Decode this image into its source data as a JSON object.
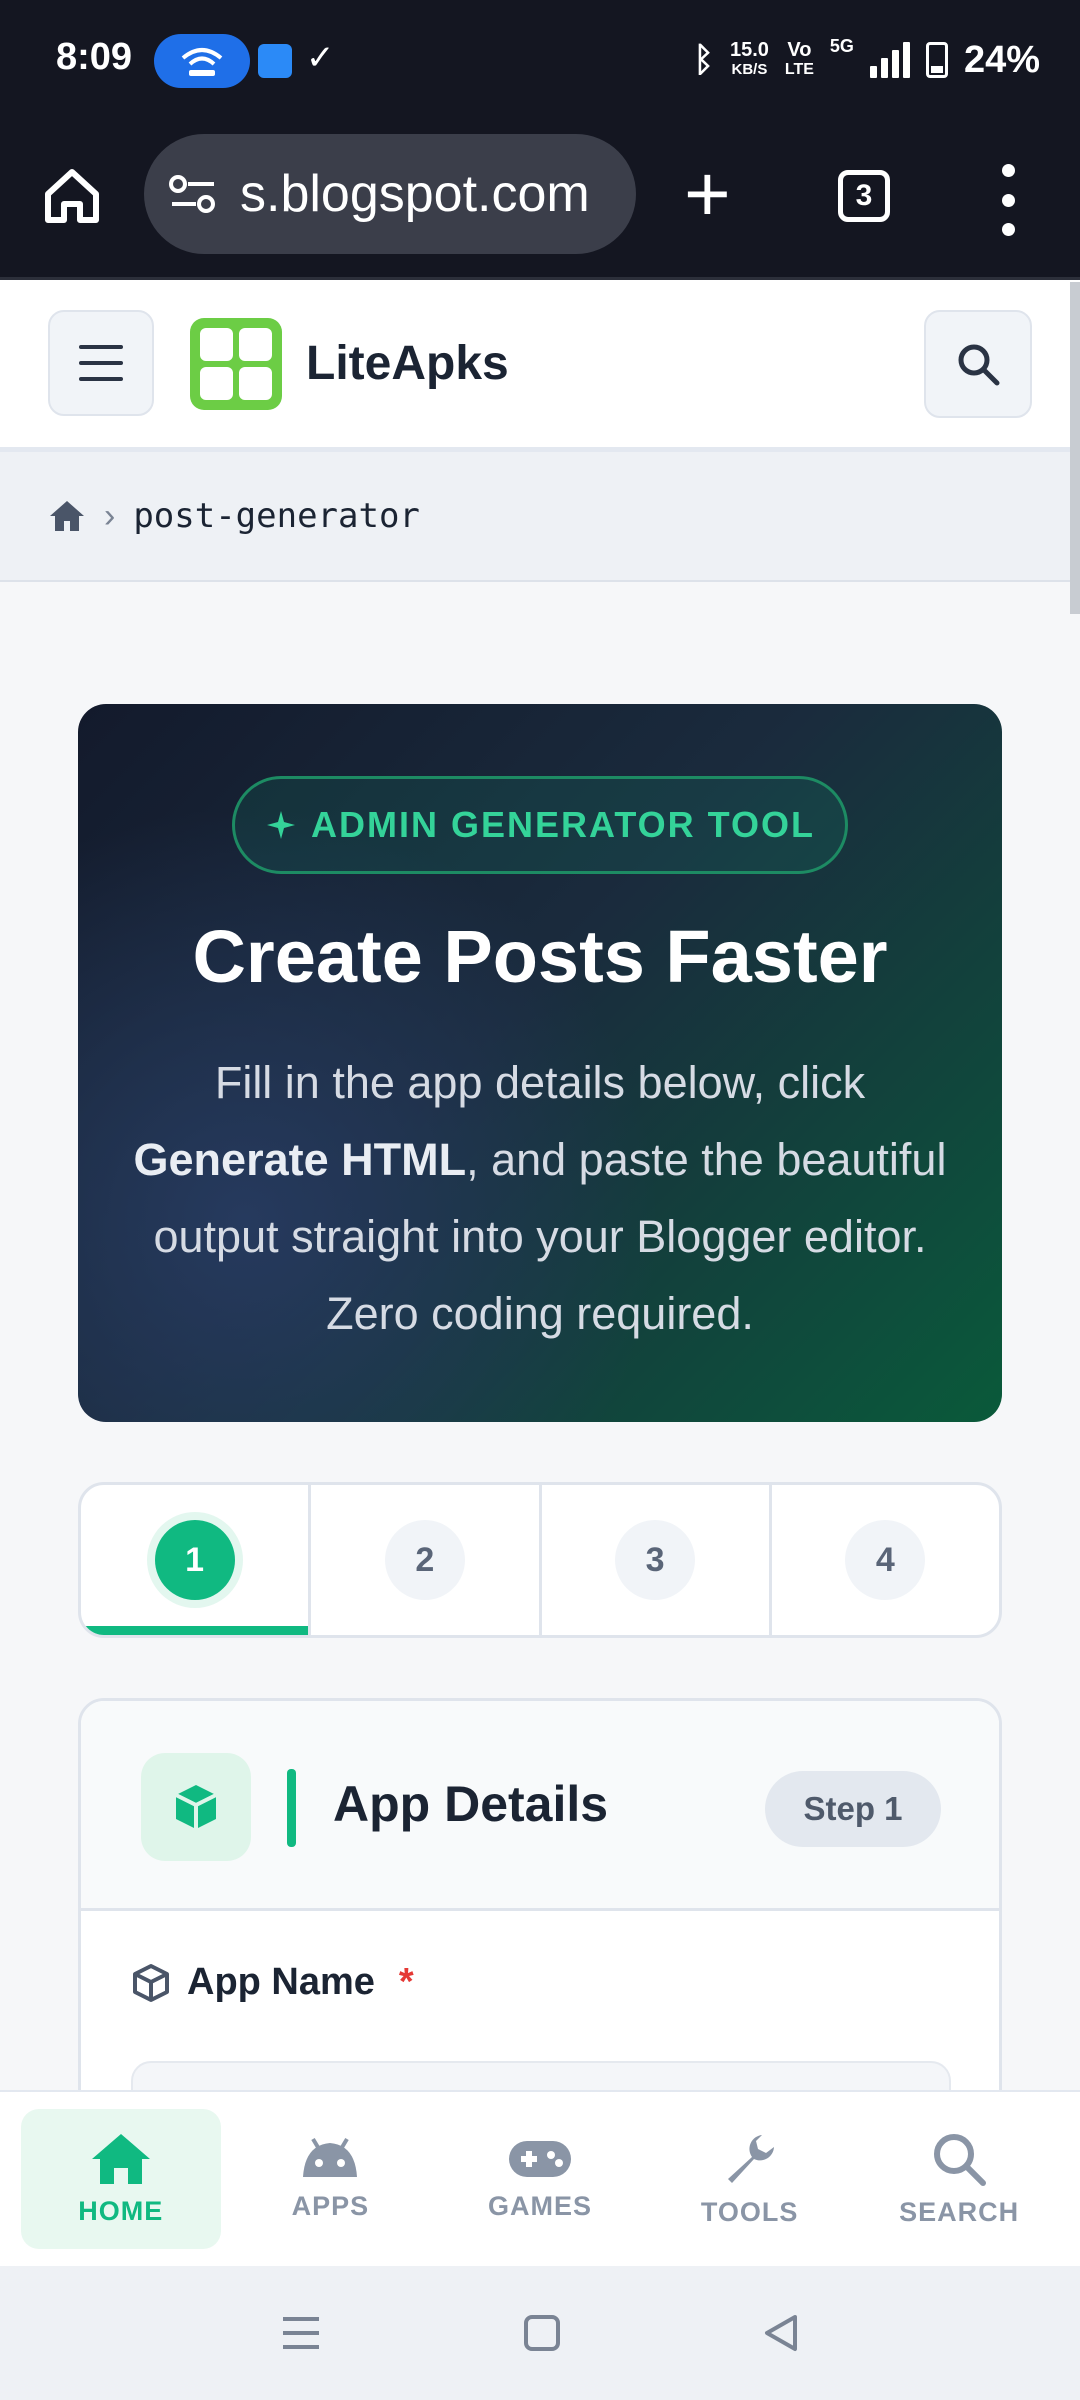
{
  "status_bar": {
    "time": "8:09",
    "net_speed_value": "15.0",
    "net_speed_unit": "KB/S",
    "volte_top": "Vo",
    "volte_bottom": "LTE",
    "network": "5G",
    "battery": "24%"
  },
  "browser": {
    "url": "s.blogspot.com",
    "tab_count": "3"
  },
  "site": {
    "brand": "LiteApks"
  },
  "breadcrumb": {
    "path": "post-generator"
  },
  "hero": {
    "badge": "ADMIN GENERATOR TOOL",
    "title": "Create Posts Faster",
    "desc_before": "Fill in the app details below, click ",
    "desc_bold": "Generate HTML",
    "desc_after": ", and paste the beautiful output straight into your Blogger editor. Zero coding required."
  },
  "stepper": {
    "steps": [
      "1",
      "2",
      "3",
      "4"
    ],
    "active": 1
  },
  "card": {
    "title": "App Details",
    "step_label": "Step 1",
    "field_label": "App Name",
    "required_mark": "*"
  },
  "bottom_nav": {
    "items": [
      {
        "label": "HOME",
        "icon": "home-icon",
        "active": true
      },
      {
        "label": "APPS",
        "icon": "android-icon",
        "active": false
      },
      {
        "label": "GAMES",
        "icon": "gamepad-icon",
        "active": false
      },
      {
        "label": "TOOLS",
        "icon": "wrench-icon",
        "active": false
      },
      {
        "label": "SEARCH",
        "icon": "search-icon",
        "active": false
      }
    ]
  },
  "colors": {
    "accent": "#10b981",
    "status_bar_bg": "#141621",
    "hero_badge_text": "#34d399"
  }
}
